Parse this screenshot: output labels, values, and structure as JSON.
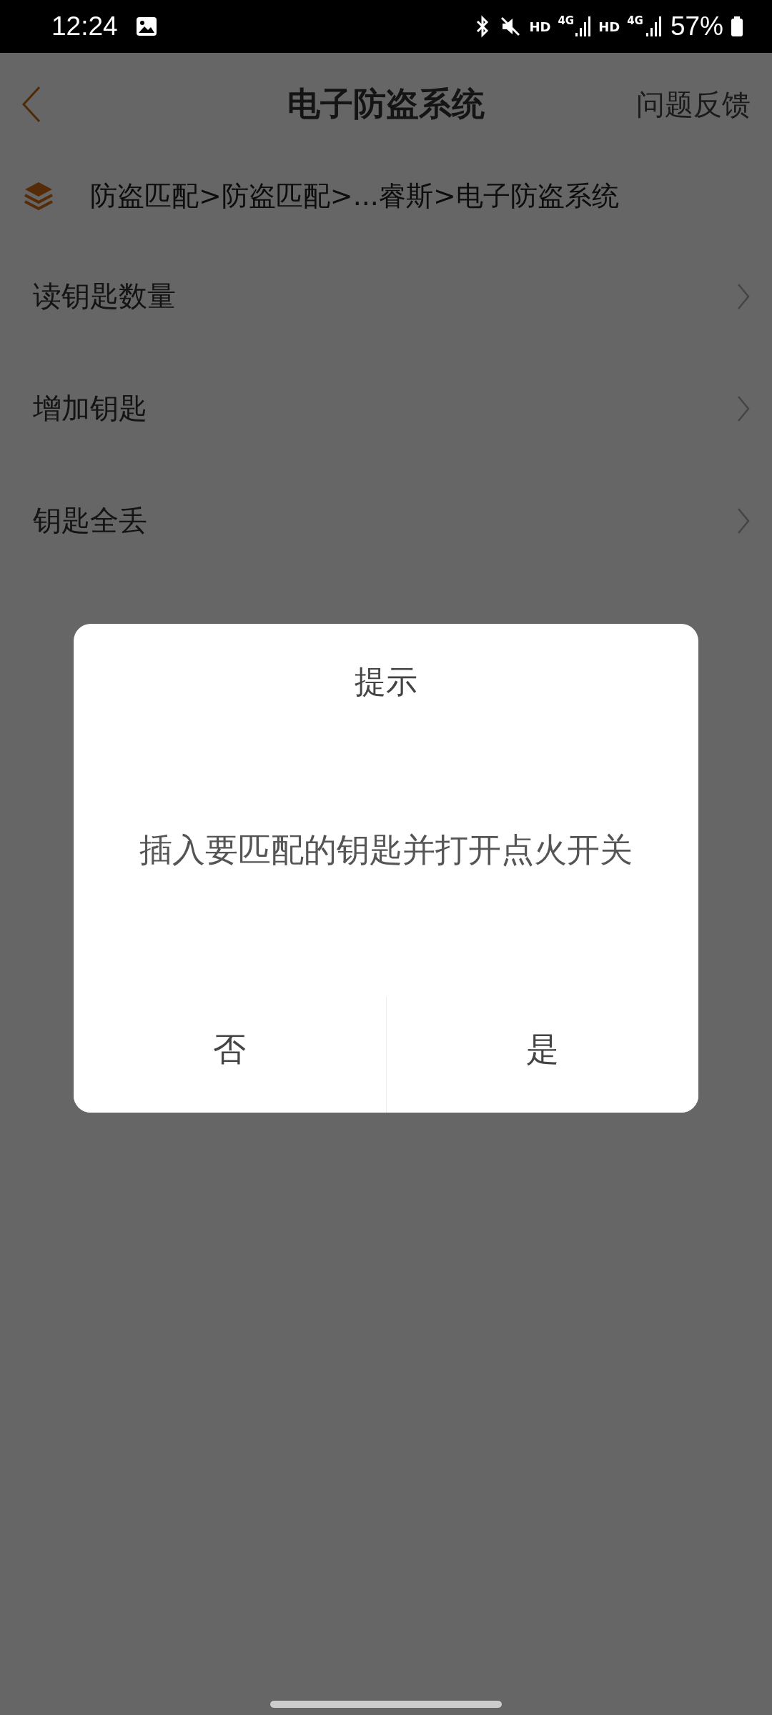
{
  "status_bar": {
    "time": "12:24",
    "indicators": [
      "HD",
      "4G",
      "HD",
      "4G"
    ],
    "battery": "57%"
  },
  "header": {
    "title": "电子防盗系统",
    "action": "问题反馈"
  },
  "breadcrumb": "防盗匹配>防盗匹配>...睿斯>电子防盗系统",
  "menu_items": [
    {
      "label": "读钥匙数量"
    },
    {
      "label": "增加钥匙"
    },
    {
      "label": "钥匙全丢"
    }
  ],
  "dialog": {
    "title": "提示",
    "message": "插入要匹配的钥匙并打开点火开关",
    "buttons": [
      {
        "label": "否"
      },
      {
        "label": "是"
      }
    ]
  }
}
